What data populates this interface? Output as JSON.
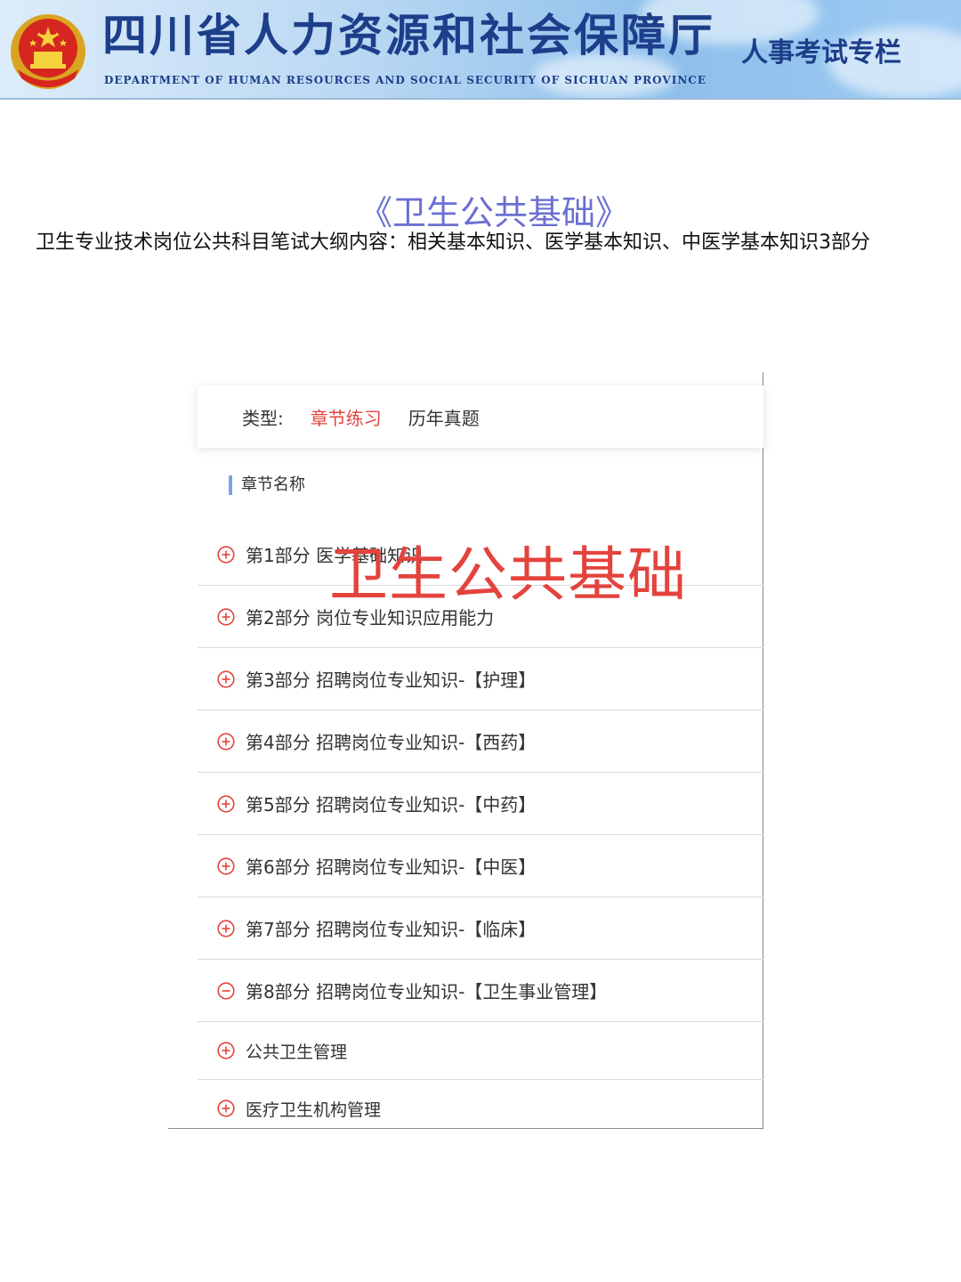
{
  "banner": {
    "title": "四川省人力资源和社会保障厅",
    "subtitle": "DEPARTMENT OF HUMAN RESOURCES AND SOCIAL SECURITY OF SICHUAN PROVINCE",
    "column": "人事考试专栏",
    "emblem_icon": "national-emblem-icon"
  },
  "heading": "《卫生公共基础》",
  "intro": "卫生专业技术岗位公共科目笔试大纲内容：相关基本知识、医学基本知识、中医学基本知识3部分",
  "panel": {
    "type_label": "类型:",
    "type_options": [
      {
        "label": "章节练习",
        "active": true
      },
      {
        "label": "历年真题",
        "active": false
      }
    ],
    "section_heading": "章节名称",
    "chapters": [
      {
        "label": "第1部分 医学基础知识",
        "icon": "plus-circle-icon"
      },
      {
        "label": "第2部分 岗位专业知识应用能力",
        "icon": "plus-circle-icon"
      },
      {
        "label": "第3部分 招聘岗位专业知识-【护理】",
        "icon": "plus-circle-icon"
      },
      {
        "label": "第4部分 招聘岗位专业知识-【西药】",
        "icon": "plus-circle-icon"
      },
      {
        "label": "第5部分 招聘岗位专业知识-【中药】",
        "icon": "plus-circle-icon"
      },
      {
        "label": "第6部分 招聘岗位专业知识-【中医】",
        "icon": "plus-circle-icon"
      },
      {
        "label": "第7部分 招聘岗位专业知识-【临床】",
        "icon": "plus-circle-icon"
      },
      {
        "label": "第8部分 招聘岗位专业知识-【卫生事业管理】",
        "icon": "minus-circle-icon"
      },
      {
        "label": "公共卫生管理",
        "icon": "plus-circle-icon"
      },
      {
        "label": "医疗卫生机构管理",
        "icon": "plus-circle-icon"
      }
    ]
  },
  "watermark": "卫生公共基础",
  "colors": {
    "accent_red": "#e4433d",
    "heading_purple": "#6b6fd2",
    "banner_blue": "#1d3e8a",
    "section_bar": "#7aa3e6"
  }
}
